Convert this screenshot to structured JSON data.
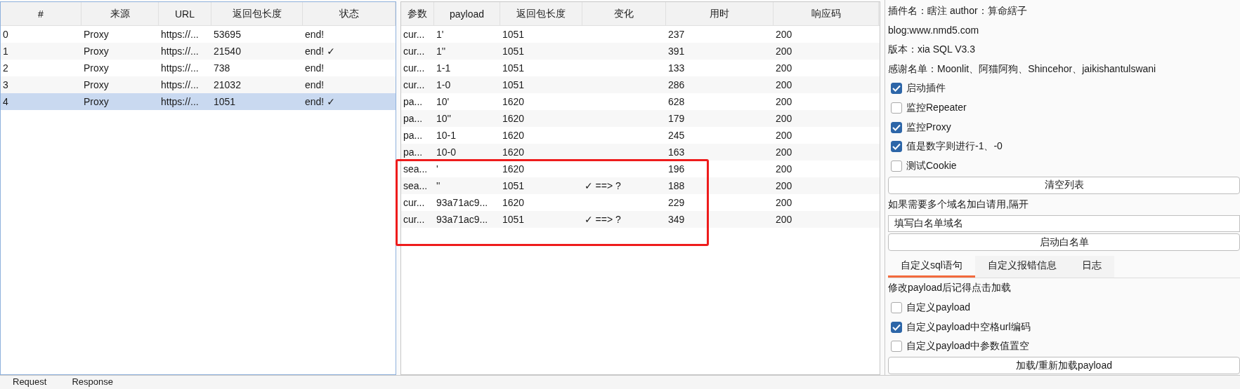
{
  "scan_table": {
    "columns": [
      "#",
      "来源",
      "URL",
      "返回包长度",
      "状态"
    ],
    "rows": [
      {
        "cells": [
          "0",
          "Proxy",
          "https://...",
          "53695",
          "end!"
        ],
        "selected": false
      },
      {
        "cells": [
          "1",
          "Proxy",
          "https://...",
          "21540",
          "end! ✓"
        ],
        "selected": false
      },
      {
        "cells": [
          "2",
          "Proxy",
          "https://...",
          "738",
          "end!"
        ],
        "selected": false
      },
      {
        "cells": [
          "3",
          "Proxy",
          "https://...",
          "21032",
          "end!"
        ],
        "selected": false
      },
      {
        "cells": [
          "4",
          "Proxy",
          "https://...",
          "1051",
          "end! ✓"
        ],
        "selected": true
      }
    ]
  },
  "payload_table": {
    "columns": [
      "参数",
      "payload",
      "返回包长度",
      "变化",
      "用时",
      "响应码"
    ],
    "rows": [
      {
        "cells": [
          "cur...",
          "1'",
          "1051",
          "",
          "237",
          "200"
        ],
        "highlighted": false
      },
      {
        "cells": [
          "cur...",
          "1''",
          "1051",
          "",
          "391",
          "200"
        ],
        "highlighted": false
      },
      {
        "cells": [
          "cur...",
          "1-1",
          "1051",
          "",
          "133",
          "200"
        ],
        "highlighted": false
      },
      {
        "cells": [
          "cur...",
          "1-0",
          "1051",
          "",
          "286",
          "200"
        ],
        "highlighted": false
      },
      {
        "cells": [
          "pa...",
          "10'",
          "1620",
          "",
          "628",
          "200"
        ],
        "highlighted": false
      },
      {
        "cells": [
          "pa...",
          "10''",
          "1620",
          "",
          "179",
          "200"
        ],
        "highlighted": false
      },
      {
        "cells": [
          "pa...",
          "10-1",
          "1620",
          "",
          "245",
          "200"
        ],
        "highlighted": false
      },
      {
        "cells": [
          "pa...",
          "10-0",
          "1620",
          "",
          "163",
          "200"
        ],
        "highlighted": false
      },
      {
        "cells": [
          "sea...",
          "'",
          "1620",
          "",
          "196",
          "200"
        ],
        "highlighted": true
      },
      {
        "cells": [
          "sea...",
          "''",
          "1051",
          "✓ ==> ?",
          "188",
          "200"
        ],
        "highlighted": true
      },
      {
        "cells": [
          "cur...",
          "93a71ac9...",
          "1620",
          "",
          "229",
          "200"
        ],
        "highlighted": true
      },
      {
        "cells": [
          "cur...",
          "93a71ac9...",
          "1051",
          "✓ ==> ?",
          "349",
          "200"
        ],
        "highlighted": true
      }
    ]
  },
  "settings": {
    "info": [
      "插件名：瞎注 author：算命縖子",
      "blog:www.nmd5.com",
      "版本：xia SQL V3.3",
      "感谢名单：Moonlit、阿猫阿狗、Shincehor、jaikishantulswani"
    ],
    "options": [
      {
        "label": "启动插件",
        "checked": true
      },
      {
        "label": "监控Repeater",
        "checked": false
      },
      {
        "label": "监控Proxy",
        "checked": true
      },
      {
        "label": "值是数字则进行-1、-0",
        "checked": true
      },
      {
        "label": "测试Cookie",
        "checked": false
      }
    ],
    "clear_button": "清空列表",
    "whitelist_hint": "如果需要多个域名加白请用,隔开",
    "whitelist_field": {
      "value": "填写白名单域名"
    },
    "whitelist_button": "启动白名单",
    "tabs": [
      {
        "label": "自定义sql语句",
        "selected": true
      },
      {
        "label": "自定义报错信息",
        "selected": false
      },
      {
        "label": "日志",
        "selected": false
      }
    ],
    "payload_hint": "修改payload后记得点击加载",
    "payload_options": [
      {
        "label": "自定义payload",
        "checked": false
      },
      {
        "label": "自定义payload中空格url编码",
        "checked": true
      },
      {
        "label": "自定义payload中参数值置空",
        "checked": false
      }
    ],
    "load_button": "加载/重新加载payload"
  },
  "bottom_tabs": [
    {
      "label": "Request"
    },
    {
      "label": "Response"
    }
  ]
}
